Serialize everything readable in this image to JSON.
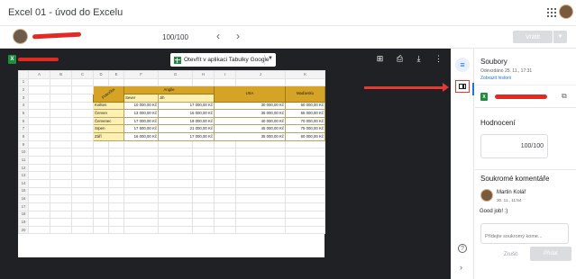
{
  "app": {
    "title": "Excel 01 - úvod do Excelu",
    "student_score": "100/100",
    "prev_icon": "chevron-left-icon",
    "next_icon": "chevron-right-icon",
    "return_label": "Vrátit",
    "colors": {
      "accent": "#1a73e8",
      "redaction": "#e12a24",
      "excel_green": "#1e8e3e",
      "header_gold": "#d5a326",
      "cell_yellow": "#fdf0b0"
    }
  },
  "viewer": {
    "open_label": "Otevřít v aplikaci Tabulky Google",
    "icons": [
      "add-comment-icon",
      "print-icon",
      "download-icon",
      "more-icon"
    ]
  },
  "sheet": {
    "columns": [
      "",
      "A",
      "B",
      "C",
      "D",
      "E",
      "F",
      "G",
      "H",
      "I",
      "J",
      "K"
    ],
    "row_numbers": [
      "1",
      "2",
      "3",
      "4",
      "5",
      "6",
      "7",
      "8",
      "9",
      "10",
      "11",
      "12",
      "13",
      "14",
      "15",
      "16",
      "17",
      "18",
      "19",
      "20"
    ],
    "corner_label": "Pobočka",
    "group_anglie": "Anglie",
    "header_usa": "USA",
    "header_madarsko": "Maďarsko",
    "sub_sever": "Sever",
    "sub_jih": "Jih",
    "rows": [
      {
        "month": "Květen",
        "sever": "10 000,00 Kč",
        "jih": "17 000,00 Kč",
        "usa": "30 000,00 Kč",
        "mad": "60 000,00 Kč"
      },
      {
        "month": "Červen",
        "sever": "13 000,00 Kč",
        "jih": "16 000,00 Kč",
        "usa": "35 000,00 Kč",
        "mad": "65 000,00 Kč"
      },
      {
        "month": "Červenec",
        "sever": "17 000,00 Kč",
        "jih": "19 000,00 Kč",
        "usa": "40 000,00 Kč",
        "mad": "70 000,00 Kč"
      },
      {
        "month": "Srpen",
        "sever": "17 500,00 Kč",
        "jih": "21 000,00 Kč",
        "usa": "45 000,00 Kč",
        "mad": "75 000,00 Kč"
      },
      {
        "month": "Září",
        "sever": "16 000,00 Kč",
        "jih": "17 000,00 Kč",
        "usa": "35 000,00 Kč",
        "mad": "60 000,00 Kč"
      }
    ]
  },
  "panel": {
    "files_title": "Soubory",
    "submitted": "Odevzdáno 25. 11., 17:31",
    "history_link": "Zobrazit historii",
    "grade_title": "Hodnocení",
    "grade_value": "100/100",
    "comments_title": "Soukromé komentáře",
    "comment_author": "Martin Kolář",
    "comment_time": "30. 11., 11:54",
    "comment_text": "Good job! :)",
    "comment_placeholder": "Přidejte soukromý kome...",
    "cancel_label": "Zrušit",
    "add_label": "Přidat"
  }
}
